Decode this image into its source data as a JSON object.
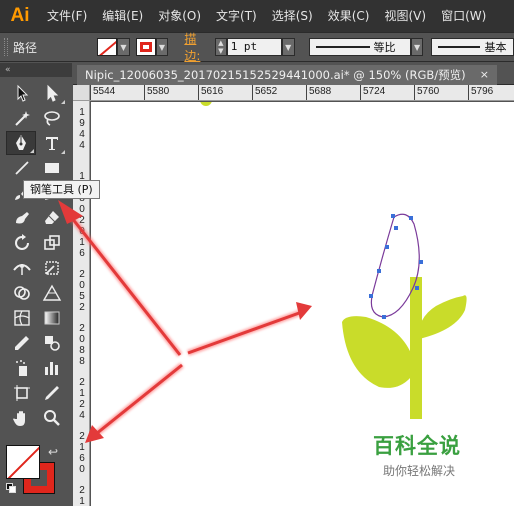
{
  "app": {
    "logo": "Ai"
  },
  "menu": [
    "文件(F)",
    "编辑(E)",
    "对象(O)",
    "文字(T)",
    "选择(S)",
    "效果(C)",
    "视图(V)",
    "窗口(W)"
  ],
  "control_bar": {
    "selection_label": "路径",
    "stroke_label": "描边:",
    "stroke_weight": "1 pt",
    "profile_label": "等比",
    "brush_label": "基本",
    "fill_color": "#ffffff",
    "stroke_color": "#e0261c"
  },
  "tool_panel": {
    "collapse_glyph": "«"
  },
  "tooltip": "钢笔工具 (P)",
  "document_tab": {
    "title": "Nipic_12006035_20170215152529441000.ai* @ 150% (RGB/预览)",
    "close": "×"
  },
  "ruler": {
    "horizontal": [
      "5544",
      "5580",
      "5616",
      "5652",
      "5688",
      "5724",
      "5760",
      "5796"
    ],
    "vertical": [
      "1",
      "9",
      "4",
      "4",
      "1",
      "9",
      "8",
      "0",
      "2",
      "0",
      "1",
      "6",
      "2",
      "0",
      "5",
      "2",
      "2",
      "0",
      "8",
      "8",
      "2",
      "1",
      "2",
      "4",
      "2",
      "1",
      "6",
      "0",
      "2",
      "1"
    ]
  },
  "artwork": {
    "stem_color": "#c9dc2a",
    "path_color": "#7a3a9a",
    "anchor_color": "#3a6fd8"
  },
  "watermark": {
    "title": "百科全说",
    "subtitle": "助你轻松解决"
  }
}
